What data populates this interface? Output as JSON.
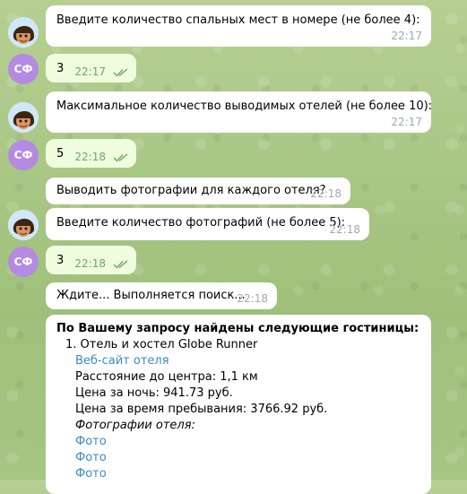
{
  "messages": [
    {
      "text": "Введите количество спальных мест в номере (не более 4):",
      "time": "22:17"
    },
    {
      "avatar": "СФ",
      "text": "3",
      "time": "22:17"
    },
    {
      "text": "Максимальное количество выводимых отелей (не более 10):",
      "time": "22:17"
    },
    {
      "avatar": "СФ",
      "text": "5",
      "time": "22:18"
    },
    {
      "text": "Выводить фотографии для каждого отеля?",
      "time": "22:18"
    },
    {
      "text": "Введите количество фотографий (не более 5):",
      "time": "22:18"
    },
    {
      "avatar": "СФ",
      "text": "3",
      "time": "22:18"
    },
    {
      "text": "Ждите... Выполняется поиск...",
      "time": "22:18"
    }
  ],
  "result": {
    "title": "По Вашему запросу найдены следующие гостиницы:",
    "hotel_name": "1. Отель и хостел Globe Runner",
    "website_link": "Веб-сайт отеля",
    "distance": "Расстояние до центра: 1,1 км",
    "price_night": "Цена за ночь: 941.73 руб.",
    "price_total": "Цена за время пребывания: 3766.92 руб.",
    "photos_label": "Фотографии отеля:",
    "photo_links": [
      "Фото",
      "Фото",
      "Фото"
    ]
  },
  "colors": {
    "incoming_bubble": "#ffffff",
    "outgoing_bubble": "#effdde",
    "link": "#3a8ac9",
    "avatar_initials_bg": "#b48be0",
    "read_check": "#6aa867"
  },
  "icons": {
    "bot_avatar": "cartoon-girl-avatar-icon",
    "read_status": "double-check-icon"
  }
}
